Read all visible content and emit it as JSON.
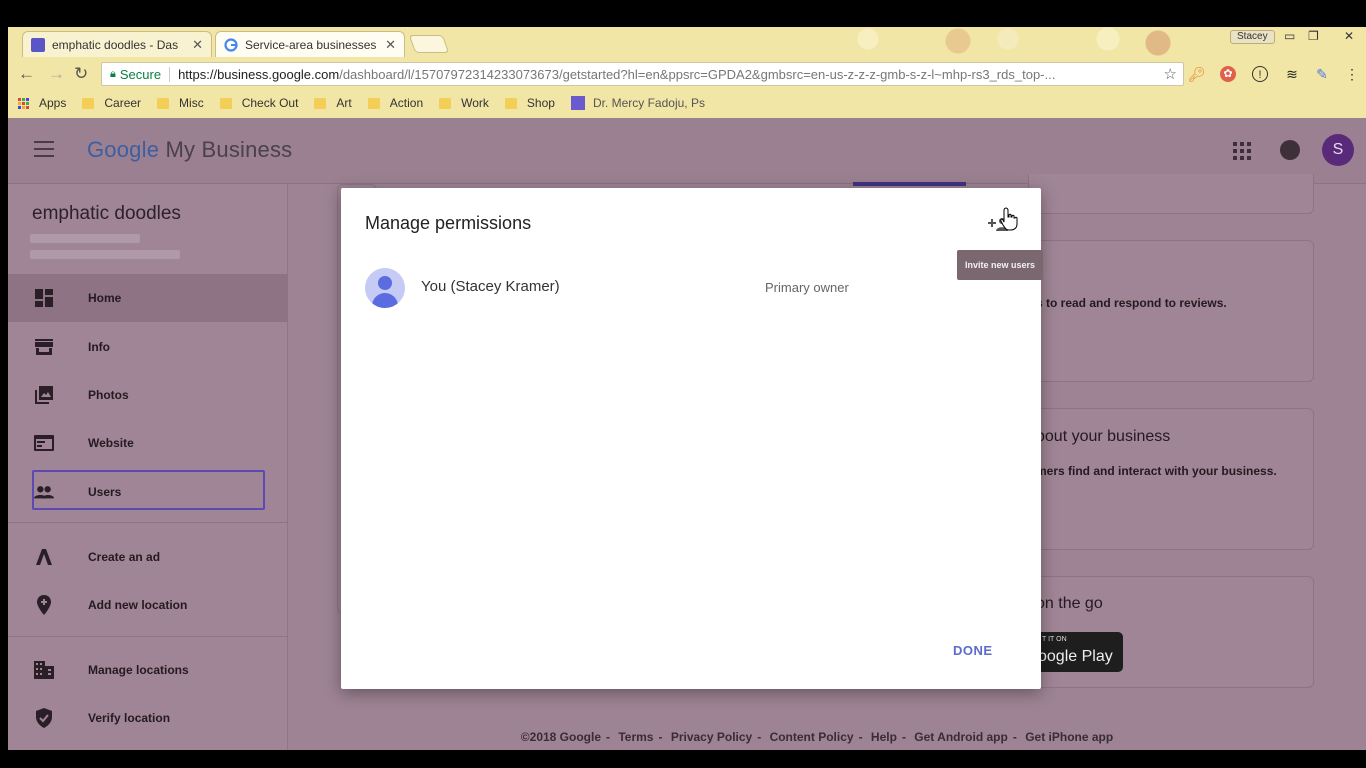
{
  "browser": {
    "tabs": [
      {
        "title": "emphatic doodles - Das",
        "close": "✕"
      },
      {
        "title": "Service-area businesses",
        "close": "✕"
      }
    ],
    "profile": "Stacey",
    "address": {
      "secure_label": "Secure",
      "url_host": "https://business.google.com",
      "url_path": "/dashboard/l/15707972314233073673/getstarted?hl=en&ppsrc=GPDA2&gmbsrc=en-us-z-z-z-gmb-s-z-l~mhp-rs3_rds_top-..."
    },
    "bookmarks": [
      "Apps",
      "Career",
      "Misc",
      "Check Out",
      "Art",
      "Action",
      "Work",
      "Shop",
      "Dr. Mercy Fadoju, Ps"
    ]
  },
  "app": {
    "logo": {
      "google": "Google",
      "product": "My Business"
    },
    "avatar_letter": "S"
  },
  "sidebar": {
    "business_name": "emphatic doodles",
    "items": [
      {
        "label": "Home",
        "icon": "dashboard-icon"
      },
      {
        "label": "Info",
        "icon": "storefront-icon"
      },
      {
        "label": "Photos",
        "icon": "photos-icon"
      },
      {
        "label": "Website",
        "icon": "website-icon"
      },
      {
        "label": "Users",
        "icon": "people-icon"
      },
      {
        "label": "Create an ad",
        "icon": "ads-icon"
      },
      {
        "label": "Add new location",
        "icon": "location-pin-icon"
      },
      {
        "label": "Manage locations",
        "icon": "buildings-icon"
      },
      {
        "label": "Verify location",
        "icon": "shield-check-icon"
      }
    ]
  },
  "background_cards": {
    "reviews_text": "s to read and respond to reviews.",
    "about_title": "bout your business",
    "about_text": "mers find and interact with your business.",
    "go_title": "on the go",
    "play_small": "T IT ON",
    "play_big": "oogle Play"
  },
  "footer": [
    "©2018 Google",
    "Terms",
    "Privacy Policy",
    "Content Policy",
    "Help",
    "Get Android app",
    "Get iPhone app"
  ],
  "dialog": {
    "title": "Manage permissions",
    "user_name": "You (Stacey Kramer)",
    "user_role": "Primary owner",
    "done_label": "DONE",
    "invite_tooltip": "Invite new users"
  }
}
